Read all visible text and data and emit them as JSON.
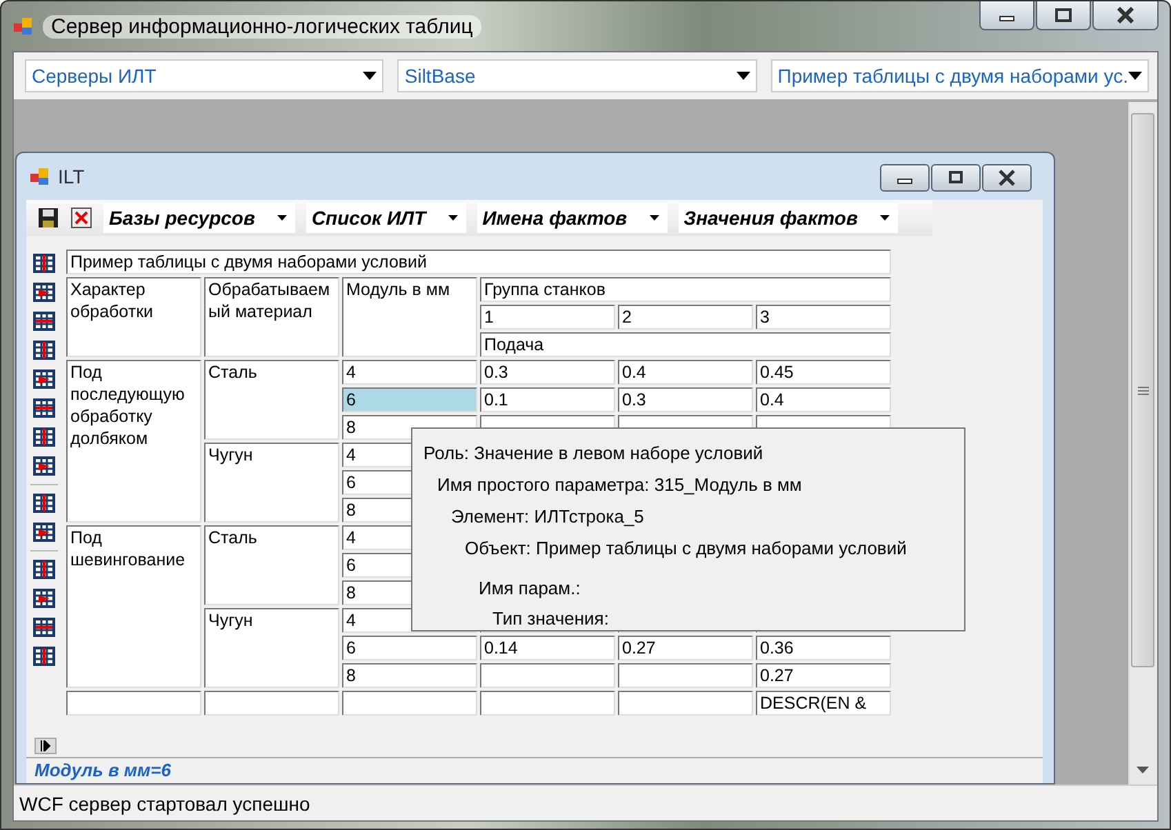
{
  "window": {
    "title": "Сервер информационно-логических таблиц"
  },
  "combos": [
    {
      "value": "Серверы ИЛТ"
    },
    {
      "value": "SiltBase"
    },
    {
      "value": "Пример таблицы с двумя наборами ус."
    }
  ],
  "child_window": {
    "title": "ILT",
    "toolbar": [
      {
        "label": "Базы ресурсов"
      },
      {
        "label": "Список ИЛТ"
      },
      {
        "label": "Имена фактов"
      },
      {
        "label": "Значения фактов"
      }
    ],
    "table": {
      "title": "Пример таблицы с двумя наборами условий",
      "header": {
        "column_1": "Характер обработки",
        "column_2": "Обрабатываемый материал",
        "column_3": "Модуль в мм",
        "group": "Группа станков",
        "group_columns": [
          "1",
          "2",
          "3"
        ],
        "sub_label": "Подача"
      },
      "groups": [
        {
          "label": "Под последующую обработку долбяком",
          "materials": [
            {
              "name": "Сталь",
              "rows": [
                {
                  "modul": "4",
                  "selected": false,
                  "group_1": "0.3",
                  "group_2": "0.4",
                  "group_3": "0.45"
                },
                {
                  "modul": "6",
                  "selected": true,
                  "group_1": "0.1",
                  "group_2": "0.3",
                  "group_3": "0.4"
                },
                {
                  "modul": "8",
                  "selected": false
                }
              ]
            },
            {
              "name": "Чугун",
              "rows": [
                {
                  "modul": "4",
                  "selected": false
                },
                {
                  "modul": "6",
                  "selected": false
                },
                {
                  "modul": "8",
                  "selected": false
                }
              ]
            }
          ]
        },
        {
          "label": "Под шевингование",
          "materials": [
            {
              "name": "Сталь",
              "rows": [
                {
                  "modul": "4",
                  "selected": false
                },
                {
                  "modul": "6",
                  "selected": false
                },
                {
                  "modul": "8",
                  "selected": false
                }
              ]
            },
            {
              "name": "Чугун",
              "rows": [
                {
                  "modul": "4",
                  "selected": false
                },
                {
                  "modul": "6",
                  "selected": false,
                  "group_1": "0.14",
                  "group_2": "0.27",
                  "group_3": "0.36"
                },
                {
                  "modul": "8",
                  "selected": false,
                  "group_3": "0.27"
                }
              ]
            }
          ]
        }
      ],
      "footer": {
        "column_6": "DESCR(EN &"
      }
    },
    "tooltip": [
      "Роль: Значение в левом наборе условий",
      "Имя простого параметра: 315_Модуль в мм",
      "Элемент: ИЛТстрока_5",
      "Объект: Пример таблицы с двумя наборами условий",
      "Имя парам.:",
      "Тип значения:"
    ],
    "bottom_text": "Модуль в мм=6"
  },
  "status_bar": {
    "text": "WCF сервер стартовал успешно"
  }
}
